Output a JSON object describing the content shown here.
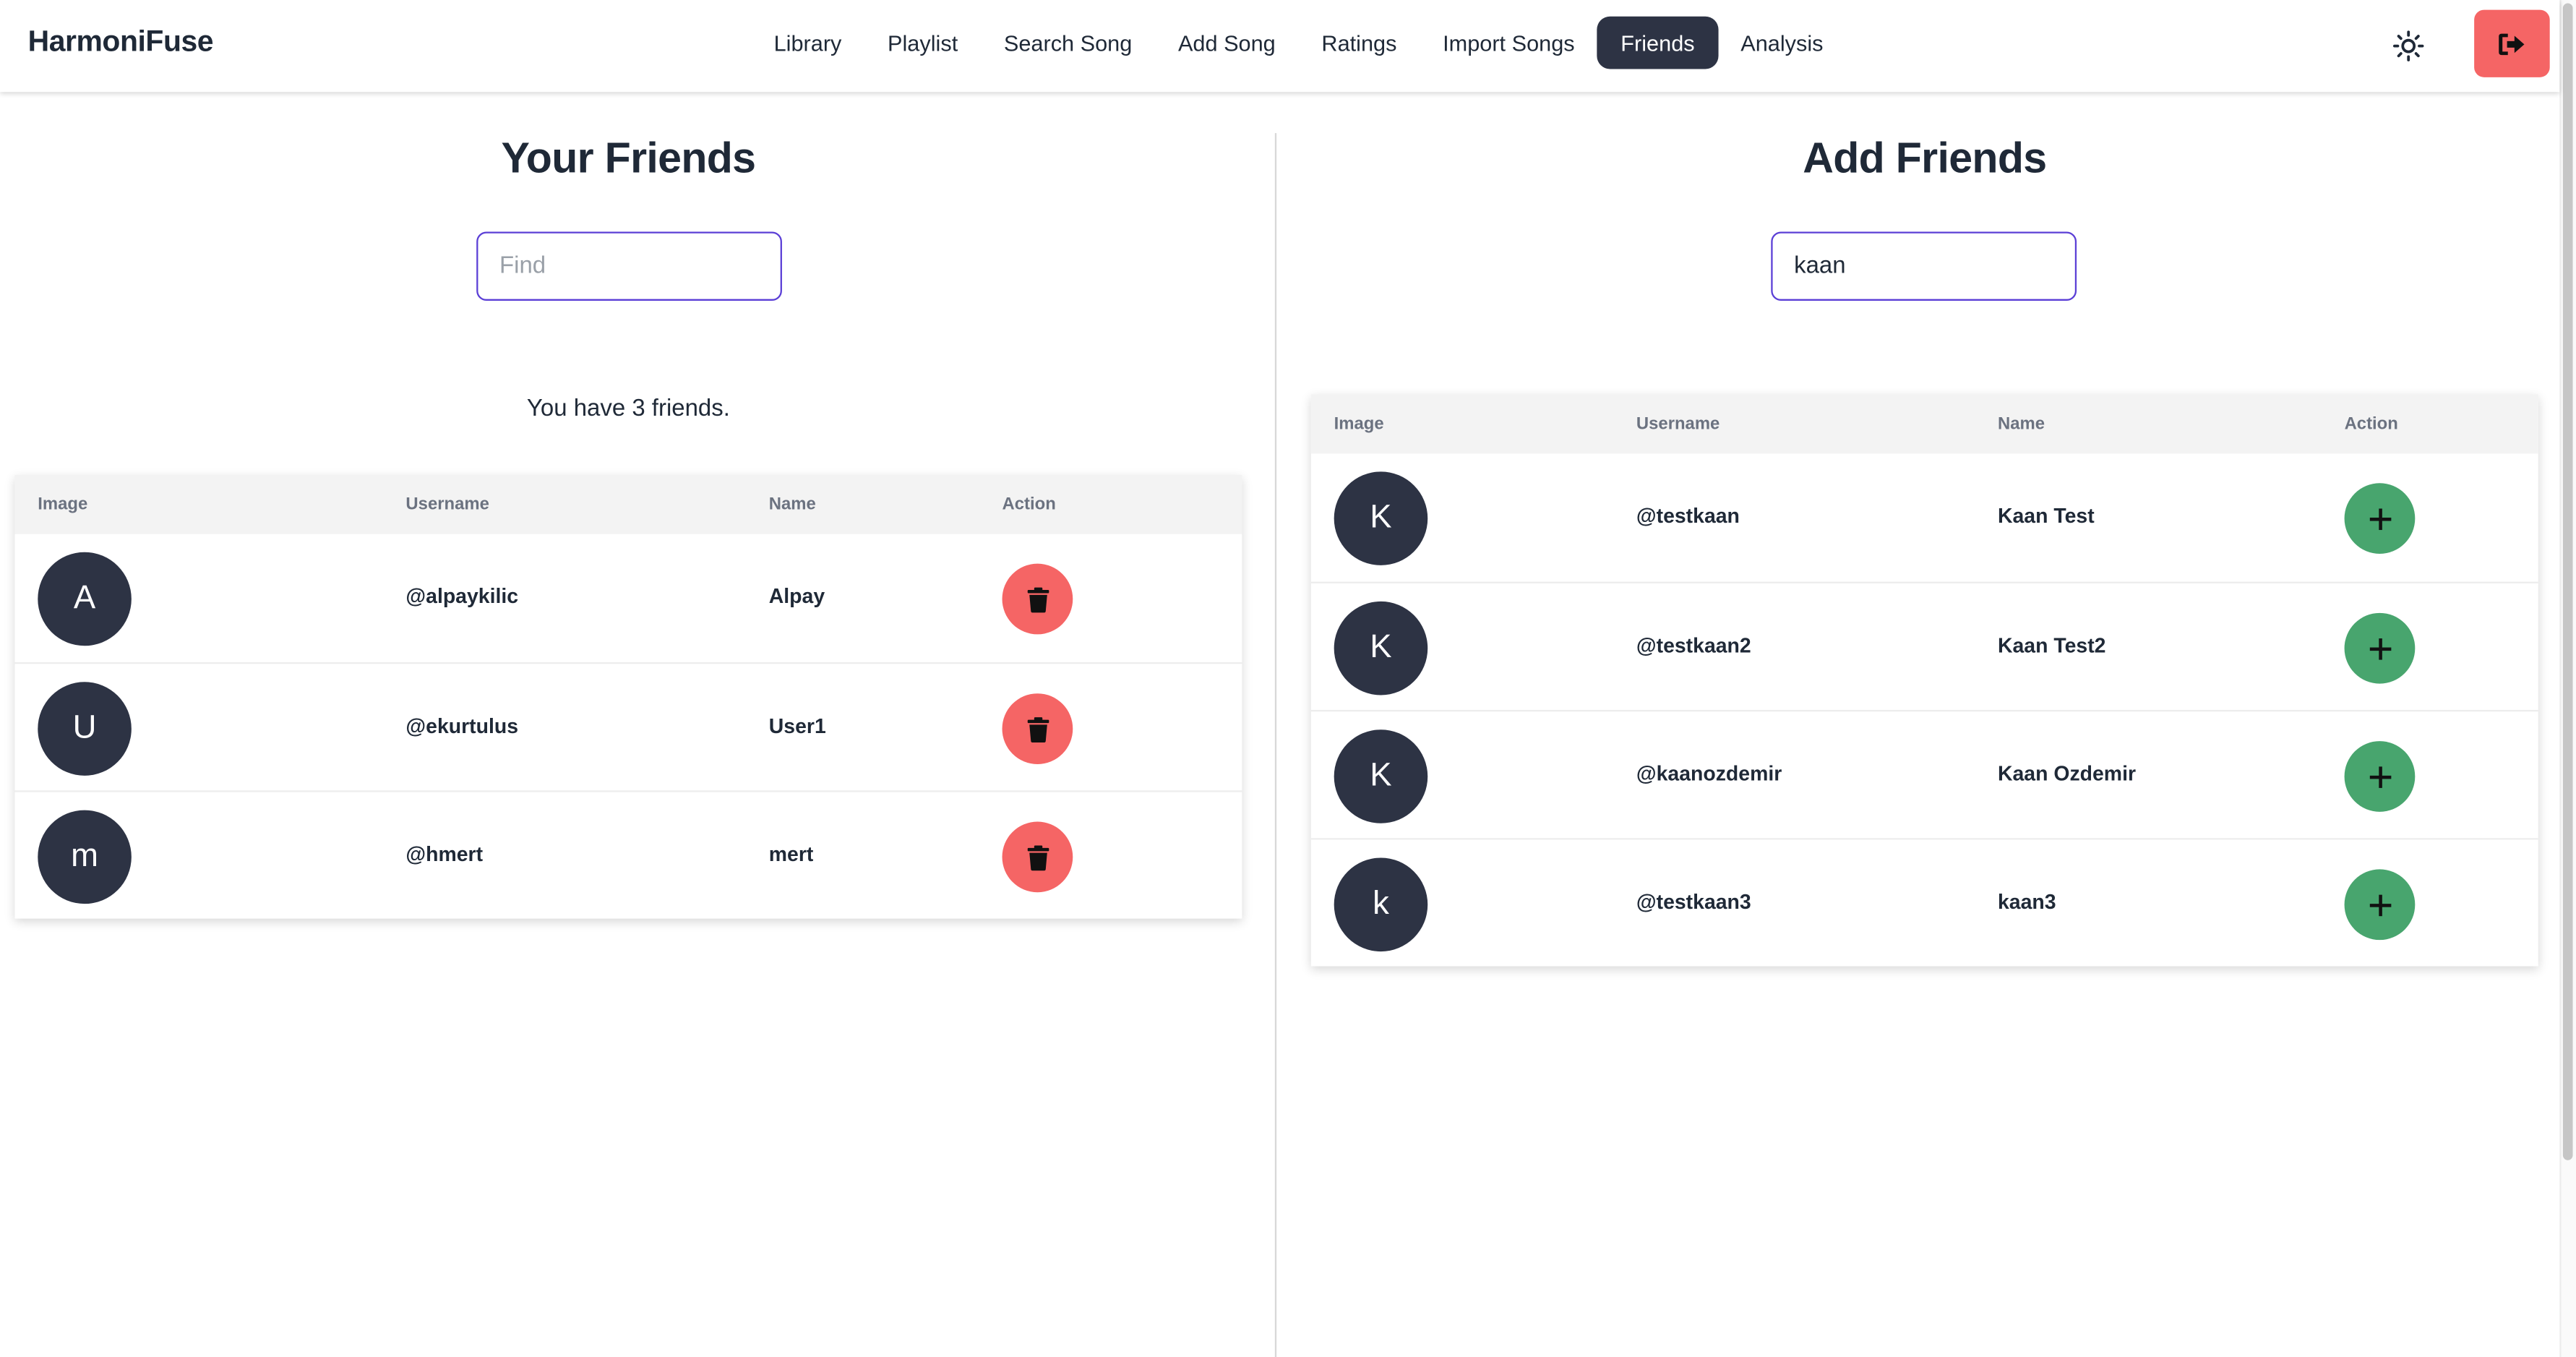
{
  "app": {
    "brand": "HarmoniFuse"
  },
  "nav": {
    "items": [
      {
        "label": "Library",
        "active": false
      },
      {
        "label": "Playlist",
        "active": false
      },
      {
        "label": "Search Song",
        "active": false
      },
      {
        "label": "Add Song",
        "active": false
      },
      {
        "label": "Ratings",
        "active": false
      },
      {
        "label": "Import Songs",
        "active": false
      },
      {
        "label": "Friends",
        "active": true
      },
      {
        "label": "Analysis",
        "active": false
      }
    ],
    "theme_icon": "sun-icon",
    "logout_icon": "logout-icon"
  },
  "your_friends": {
    "title": "Your Friends",
    "search": {
      "placeholder": "Find",
      "value": ""
    },
    "count_text": "You have 3 friends.",
    "columns": [
      "Image",
      "Username",
      "Name",
      "Action"
    ],
    "rows": [
      {
        "initial": "A",
        "username": "@alpaykilic",
        "name": "Alpay",
        "action_icon": "trash-icon"
      },
      {
        "initial": "U",
        "username": "@ekurtulus",
        "name": "User1",
        "action_icon": "trash-icon"
      },
      {
        "initial": "m",
        "username": "@hmert",
        "name": "mert",
        "action_icon": "trash-icon"
      }
    ]
  },
  "add_friends": {
    "title": "Add Friends",
    "search": {
      "placeholder": "Find",
      "value": "kaan"
    },
    "columns": [
      "Image",
      "Username",
      "Name",
      "Action"
    ],
    "rows": [
      {
        "initial": "K",
        "username": "@testkaan",
        "name": "Kaan Test",
        "action_icon": "plus-icon"
      },
      {
        "initial": "K",
        "username": "@testkaan2",
        "name": "Kaan Test2",
        "action_icon": "plus-icon"
      },
      {
        "initial": "K",
        "username": "@kaanozdemir",
        "name": "Kaan Ozdemir",
        "action_icon": "plus-icon"
      },
      {
        "initial": "k",
        "username": "@testkaan3",
        "name": "kaan3",
        "action_icon": "plus-icon"
      }
    ]
  },
  "colors": {
    "active_nav": "#2d3344",
    "delete": "#f56565",
    "add": "#48a56e",
    "avatar": "#2d3344",
    "input_border": "#5b3fd6"
  }
}
